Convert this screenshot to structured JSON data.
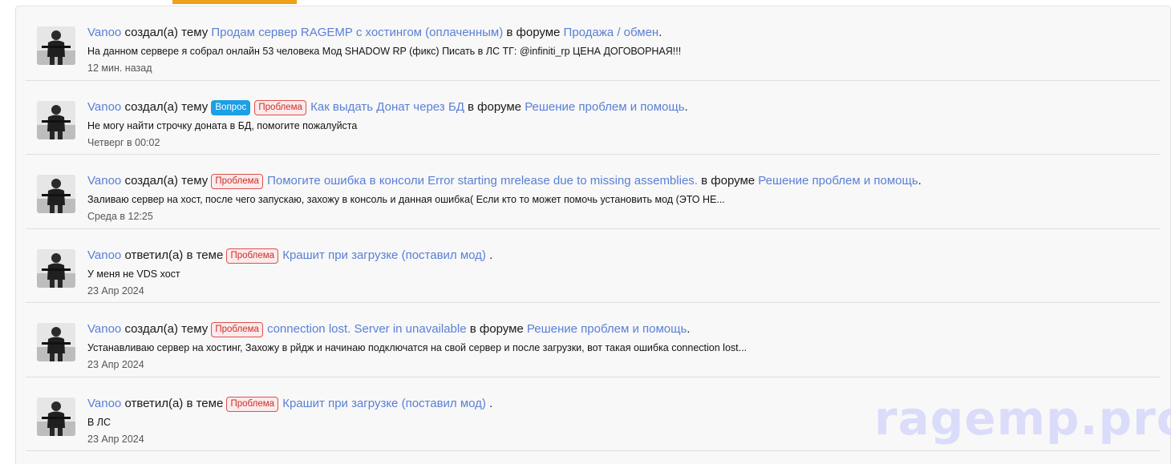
{
  "watermark": "ragemp.pro",
  "colors": {
    "link": "#5a7fd6",
    "tab_accent": "#f0a018",
    "label_question": "#1b9fe6",
    "label_problem": "#d9534f"
  },
  "items": [
    {
      "user": "Vanoo",
      "action": "создал(а) тему",
      "labels": [],
      "title": "Продам сервер RAGEMP с хостингом (оплаченным)",
      "forum_prefix": "в форуме",
      "forum": "Продажа / обмен",
      "end": ".",
      "snippet": "На данном сервере я собрал онлайн 53 человека Мод SHADOW RP (фикс) Писать в ЛС ТГ: @infiniti_rp ЦЕНА ДОГОВОРНАЯ!!!",
      "time": "12 мин. назад"
    },
    {
      "user": "Vanoo",
      "action": "создал(а) тему",
      "labels": [
        "Вопрос",
        "Проблема"
      ],
      "title": "Как выдать Донат через БД",
      "forum_prefix": "в форуме",
      "forum": "Решение проблем и помощь",
      "end": ".",
      "snippet": "Не могу найти строчку доната в БД, помогите пожалуйста",
      "time": "Четверг в 00:02"
    },
    {
      "user": "Vanoo",
      "action": "создал(а) тему",
      "labels": [
        "Проблема"
      ],
      "title": "Помогите ошибка в консоли Error starting mrelease due to missing assemblies.",
      "forum_prefix": "в форуме",
      "forum": "Решение проблем и помощь",
      "end": ".",
      "snippet": "Заливаю сервер на хост, после чего запускаю, захожу в консоль и данная ошибка( Если кто то может помочь установить мод (ЭТО НЕ...",
      "time": "Среда в 12:25"
    },
    {
      "user": "Vanoo",
      "action": "ответил(а) в теме",
      "labels": [
        "Проблема"
      ],
      "title": "Крашит при загрузке (поставил мод)",
      "forum_prefix": "",
      "forum": "",
      "end": ".",
      "snippet": "У меня не VDS хост",
      "time": "23 Апр 2024"
    },
    {
      "user": "Vanoo",
      "action": "создал(а) тему",
      "labels": [
        "Проблема"
      ],
      "title": "connection lost. Server in unavailable",
      "forum_prefix": "в форуме",
      "forum": "Решение проблем и помощь",
      "end": ".",
      "snippet": "Устанавливаю сервер на хостинг, Захожу в рйдж и начинаю подключатся на свой сервер и после загрузки, вот такая ошибка connection lost...",
      "time": "23 Апр 2024"
    },
    {
      "user": "Vanoo",
      "action": "ответил(а) в теме",
      "labels": [
        "Проблема"
      ],
      "title": "Крашит при загрузке (поставил мод)",
      "forum_prefix": "",
      "forum": "",
      "end": ".",
      "snippet": "В ЛС",
      "time": "23 Апр 2024"
    }
  ]
}
